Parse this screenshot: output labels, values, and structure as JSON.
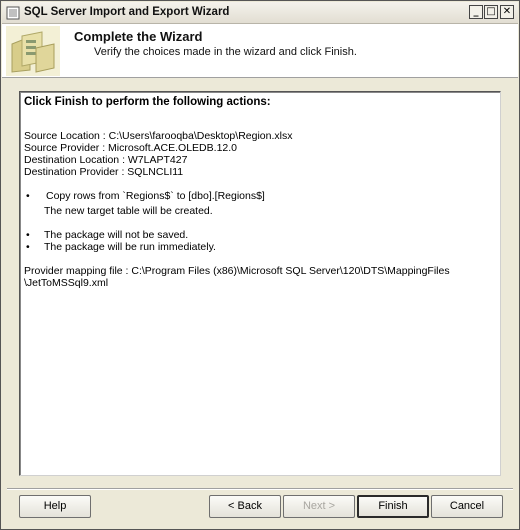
{
  "window": {
    "title": "SQL Server Import and Export Wizard",
    "controls": {
      "minimize": "_",
      "maximize": "□",
      "close": "✕"
    }
  },
  "header": {
    "title": "Complete the Wizard",
    "subtitle": "Verify the choices made in the wizard and click Finish."
  },
  "summary": {
    "intro": "Click Finish to perform the following actions:",
    "source_location": "Source Location : C:\\Users\\farooqba\\Desktop\\Region.xlsx",
    "source_provider": "Source Provider : Microsoft.ACE.OLEDB.12.0",
    "destination_location": "Destination Location : W7LAPT427",
    "destination_provider": "Destination Provider : SQLNCLI11",
    "bullet": "•",
    "copy_rows": "Copy rows from `Regions$` to [dbo].[Regions$]",
    "new_table": "The new target table will be created.",
    "not_saved": "The package will not be saved.",
    "run_immediately": "The package will be run immediately.",
    "mapping_line1": "Provider mapping file : C:\\Program Files (x86)\\Microsoft SQL Server\\120\\DTS\\MappingFiles",
    "mapping_line2": "\\JetToMSSql9.xml"
  },
  "buttons": {
    "help": "Help",
    "back": "< Back",
    "next": "Next >",
    "finish": "Finish",
    "cancel": "Cancel"
  }
}
